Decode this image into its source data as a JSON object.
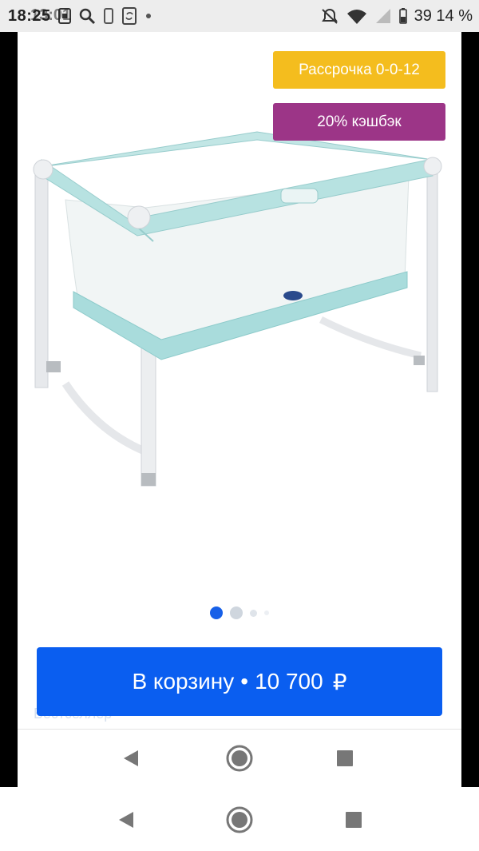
{
  "status_bar": {
    "time": "18:25",
    "ghost_time": "13:01",
    "battery_text": "39 14 %",
    "icons": [
      "notification-icon",
      "screenshot-icon",
      "search-icon",
      "phone-icon",
      "sync-icon",
      "dot-icon",
      "mute-icon",
      "wifi-icon",
      "signal-icon",
      "battery-icon"
    ]
  },
  "badges": {
    "installment": "Рассрочка 0-0-12",
    "cashback": "20% кэшбэк"
  },
  "gallery": {
    "dots_count": 4,
    "active_index": 0
  },
  "ghost_label": "Бестселлер",
  "cart": {
    "label": "В корзину",
    "separator": "•",
    "price": "10 700",
    "currency": "₽"
  },
  "colors": {
    "installment_badge": "#f4bd1e",
    "cashback_badge": "#9c3587",
    "primary_button": "#0a5ef0",
    "active_dot": "#1760e8"
  },
  "nav_icons": [
    "back-icon",
    "home-icon",
    "recents-icon"
  ]
}
